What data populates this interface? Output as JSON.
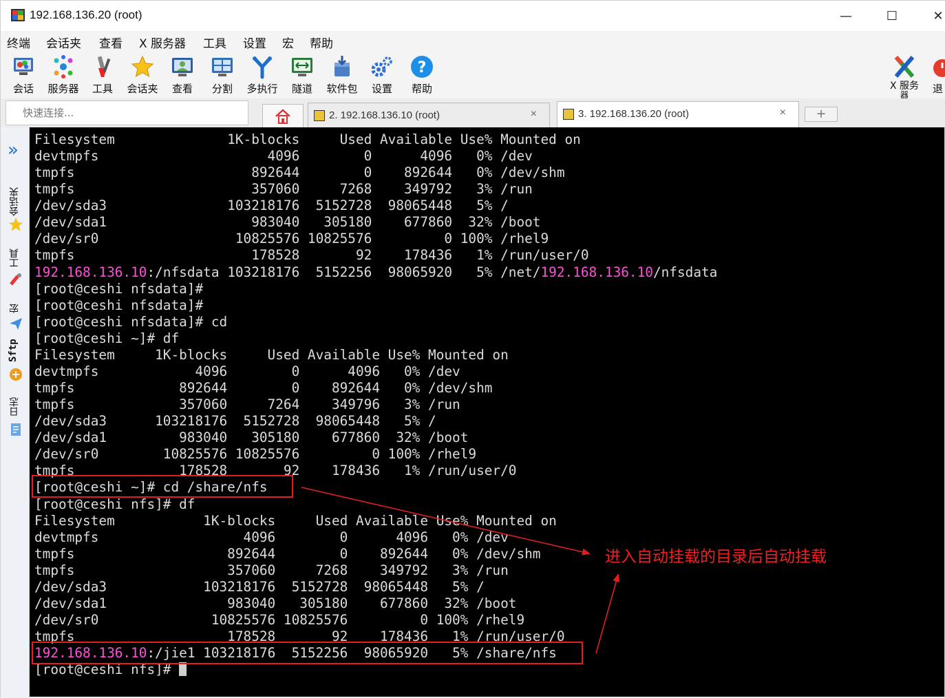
{
  "window": {
    "title": "192.168.136.20 (root)",
    "minimize": "—",
    "maximize": "☐",
    "close": "✕"
  },
  "menu": [
    "终端",
    "会话夹",
    "查看",
    "X 服务器",
    "工具",
    "设置",
    "宏",
    "帮助"
  ],
  "toolbar": {
    "items": [
      {
        "label": "会话",
        "icon": "session-icon"
      },
      {
        "label": "服务器",
        "icon": "servers-icon"
      },
      {
        "label": "工具",
        "icon": "tools-icon"
      },
      {
        "label": "会话夹",
        "icon": "star-icon"
      },
      {
        "label": "查看",
        "icon": "view-icon"
      },
      {
        "label": "分割",
        "icon": "split-icon"
      },
      {
        "label": "多执行",
        "icon": "multiexec-icon"
      },
      {
        "label": "隧道",
        "icon": "tunnel-icon"
      },
      {
        "label": "软件包",
        "icon": "packages-icon"
      },
      {
        "label": "设置",
        "icon": "settings-icon"
      },
      {
        "label": "帮助",
        "icon": "help-icon"
      }
    ],
    "xserver_label_1": "X 服务",
    "xserver_label_2": "器",
    "exit_label": "退"
  },
  "quick_connect": {
    "placeholder": "快速连接..."
  },
  "tabs": [
    {
      "label": "2. 192.168.136.10 (root)",
      "close": "×"
    },
    {
      "label": "3. 192.168.136.20 (root)",
      "close": "×"
    }
  ],
  "tab_add": "+",
  "sidebar": [
    "会话夹",
    "工具",
    "宏",
    "Sftp",
    "日志"
  ],
  "sidebar_expand": "»",
  "terminal": {
    "lines": [
      {
        "pre": "",
        "ip": "",
        "text": "Filesystem              1K-blocks     Used Available Use% Mounted on"
      },
      {
        "pre": "",
        "ip": "",
        "text": "devtmpfs                     4096        0      4096   0% /dev"
      },
      {
        "pre": "",
        "ip": "",
        "text": "tmpfs                      892644        0    892644   0% /dev/shm"
      },
      {
        "pre": "",
        "ip": "",
        "text": "tmpfs                      357060     7268    349792   3% /run"
      },
      {
        "pre": "",
        "ip": "",
        "text": "/dev/sda3               103218176  5152728  98065448   5% /"
      },
      {
        "pre": "",
        "ip": "",
        "text": "/dev/sda1                  983040   305180    677860  32% /boot"
      },
      {
        "pre": "",
        "ip": "",
        "text": "/dev/sr0                 10825576 10825576         0 100% /rhel9"
      },
      {
        "pre": "",
        "ip": "",
        "text": "tmpfs                      178528       92    178436   1% /run/user/0"
      },
      {
        "pre": "",
        "ip": "192.168.136.10",
        "text": ":/nfsdata 103218176  5152256  98065920   5% /net/",
        "ip2": "192.168.136.10",
        "tail": "/nfsdata"
      },
      {
        "pre": "",
        "ip": "",
        "text": "[root@ceshi nfsdata]#"
      },
      {
        "pre": "",
        "ip": "",
        "text": "[root@ceshi nfsdata]#"
      },
      {
        "pre": "",
        "ip": "",
        "text": "[root@ceshi nfsdata]# cd"
      },
      {
        "pre": "",
        "ip": "",
        "text": "[root@ceshi ~]# df"
      },
      {
        "pre": "",
        "ip": "",
        "text": "Filesystem     1K-blocks     Used Available Use% Mounted on"
      },
      {
        "pre": "",
        "ip": "",
        "text": "devtmpfs            4096        0      4096   0% /dev"
      },
      {
        "pre": "",
        "ip": "",
        "text": "tmpfs             892644        0    892644   0% /dev/shm"
      },
      {
        "pre": "",
        "ip": "",
        "text": "tmpfs             357060     7264    349796   3% /run"
      },
      {
        "pre": "",
        "ip": "",
        "text": "/dev/sda3      103218176  5152728  98065448   5% /"
      },
      {
        "pre": "",
        "ip": "",
        "text": "/dev/sda1         983040   305180    677860  32% /boot"
      },
      {
        "pre": "",
        "ip": "",
        "text": "/dev/sr0        10825576 10825576         0 100% /rhel9"
      },
      {
        "pre": "",
        "ip": "",
        "text": "tmpfs             178528       92    178436   1% /run/user/0"
      },
      {
        "pre": "",
        "ip": "",
        "text": "[root@ceshi ~]# cd /share/nfs"
      },
      {
        "pre": "",
        "ip": "",
        "text": "[root@ceshi nfs]# df"
      },
      {
        "pre": "",
        "ip": "",
        "text": "Filesystem           1K-blocks     Used Available Use% Mounted on"
      },
      {
        "pre": "",
        "ip": "",
        "text": "devtmpfs                  4096        0      4096   0% /dev"
      },
      {
        "pre": "",
        "ip": "",
        "text": "tmpfs                   892644        0    892644   0% /dev/shm"
      },
      {
        "pre": "",
        "ip": "",
        "text": "tmpfs                   357060     7268    349792   3% /run"
      },
      {
        "pre": "",
        "ip": "",
        "text": "/dev/sda3            103218176  5152728  98065448   5% /"
      },
      {
        "pre": "",
        "ip": "",
        "text": "/dev/sda1               983040   305180    677860  32% /boot"
      },
      {
        "pre": "",
        "ip": "",
        "text": "/dev/sr0              10825576 10825576         0 100% /rhel9"
      },
      {
        "pre": "",
        "ip": "",
        "text": "tmpfs                   178528       92    178436   1% /run/user/0"
      },
      {
        "pre": "",
        "ip": "192.168.136.10",
        "text": ":/jie1 103218176  5152256  98065920   5% /share/nfs"
      },
      {
        "pre": "",
        "ip": "",
        "text": "[root@ceshi nfs]# ",
        "cursor": true
      }
    ]
  },
  "annotation": "进入自动挂载的目录后自动挂载",
  "colors": {
    "terminal_bg": "#000000",
    "terminal_fg": "#dcdcdc",
    "ip_highlight": "#ff4fd8",
    "annotation_red": "#e02020"
  }
}
